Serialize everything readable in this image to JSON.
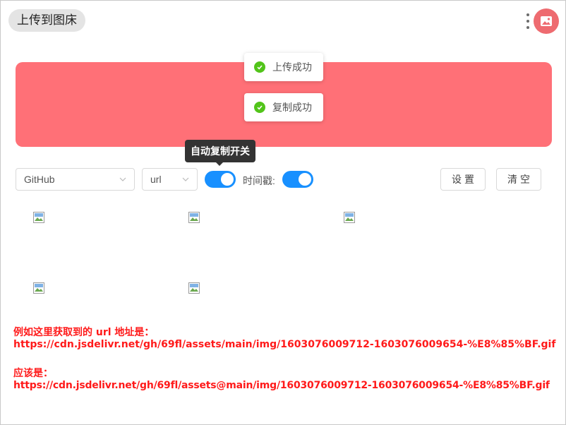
{
  "header": {
    "title": "上传到图床"
  },
  "toasts": [
    {
      "text": "上传成功"
    },
    {
      "text": "复制成功"
    }
  ],
  "tooltip": {
    "text": "自动复制开关"
  },
  "toolbar": {
    "host_select": "GitHub",
    "format_select": "url",
    "auto_copy_on": true,
    "timestamp_label": "时间戳:",
    "timestamp_on": true,
    "settings_label": "设置",
    "clear_label": "清空"
  },
  "images": {
    "count": 5
  },
  "note": {
    "line1": "例如这里获取到的 url 地址是：",
    "line2": "https://cdn.jsdelivr.net/gh/69fl/assets/main/img/1603076009712-1603076009654-%E8%85%BF.gif",
    "line3": "应该是：",
    "line4": "https://cdn.jsdelivr.net/gh/69fl/assets@main/img/1603076009712-1603076009654-%E8%85%BF.gif"
  },
  "colors": {
    "dropzone": "#ff7077",
    "accent": "#1890ff",
    "avatar": "#ee6b70",
    "note": "#ff1a1a",
    "success": "#52c41a"
  }
}
